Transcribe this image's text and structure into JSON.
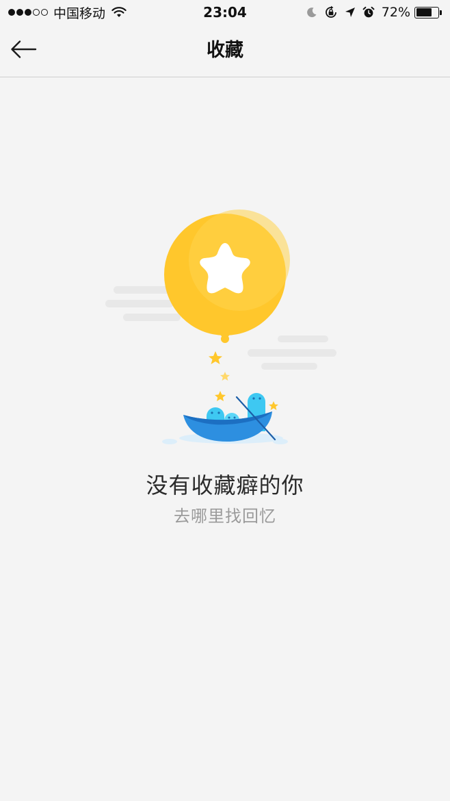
{
  "status_bar": {
    "carrier": "中国移动",
    "time": "23:04",
    "battery_percent": "72%",
    "battery_level": 0.72,
    "signal_bars_filled": 3,
    "signal_bars_total": 5,
    "icons": [
      "wifi-icon",
      "moon-icon",
      "rotation-lock-icon",
      "location-arrow-icon",
      "alarm-icon",
      "battery-icon"
    ]
  },
  "nav": {
    "title": "收藏",
    "back_icon": "arrow-left-icon"
  },
  "empty_state": {
    "title": "没有收藏癖的你",
    "subtitle": "去哪里找回忆",
    "illustration": "star-balloon-boat-illustration"
  },
  "colors": {
    "background": "#f4f4f4",
    "balloon_yellow": "#ffc933",
    "boat_blue": "#2d8fe0",
    "ghost_cyan": "#3ec8f2",
    "cloud_gray": "#e6e6e6",
    "subtitle_gray": "#9a9a9a"
  }
}
